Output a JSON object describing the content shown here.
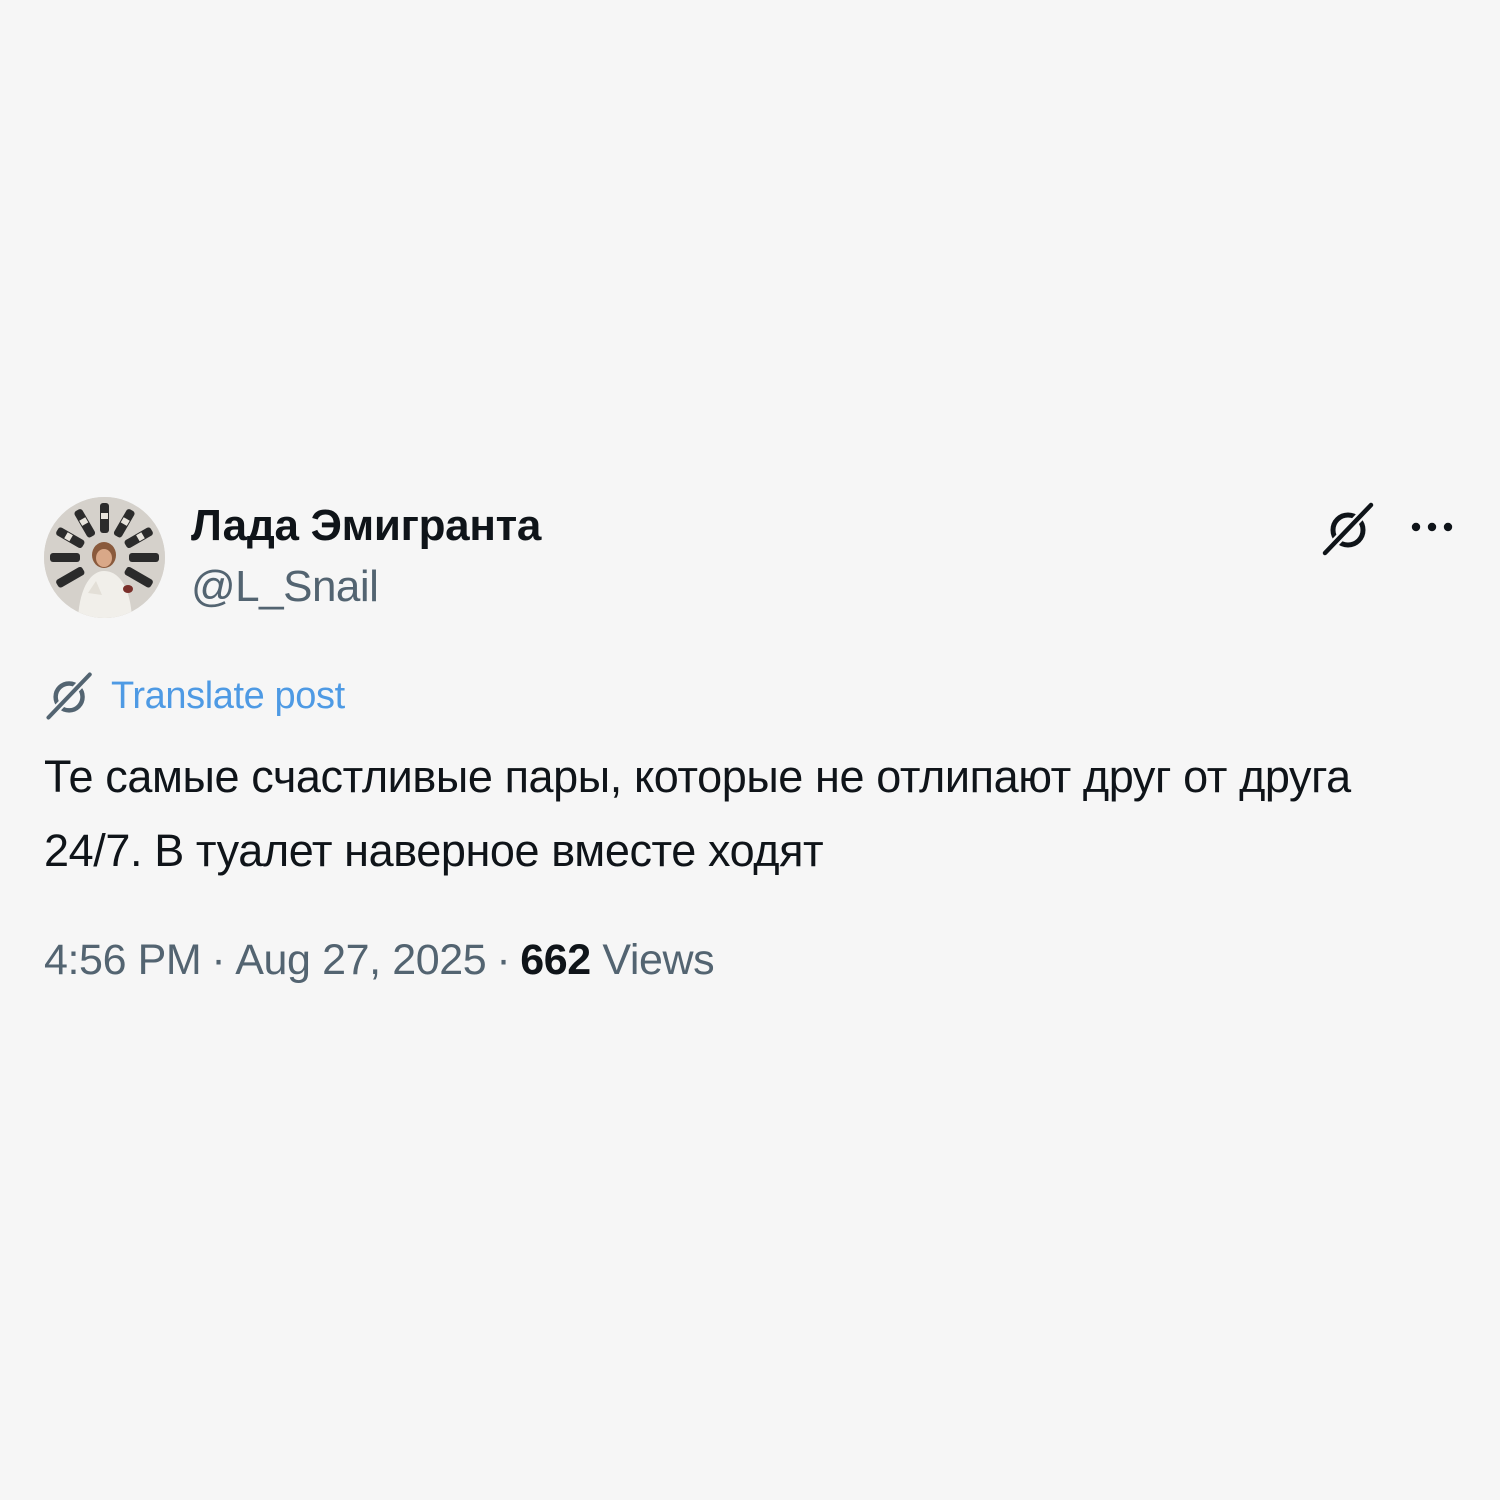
{
  "author": {
    "display_name": "Лада Эмигранта",
    "handle": "@L_Snail",
    "avatar_icon": "profile-photo-avatar"
  },
  "actions": {
    "grok_icon": "grok-icon",
    "more_icon": "more-options-icon"
  },
  "translate": {
    "label": "Translate post",
    "icon": "grok-icon",
    "color": "#4e9ae4"
  },
  "post": {
    "text": "Те самые счастливые пары, которые не отлипают друг от друга 24/7. В туалет наверное вместе ходят"
  },
  "meta": {
    "time": "4:56 PM",
    "separator": "·",
    "date": "Aug 27, 2025",
    "views_count": "662",
    "views_label": "Views"
  },
  "colors": {
    "background": "#f6f6f6",
    "text_primary": "#0f1419",
    "text_secondary": "#536471",
    "link": "#4e9ae4"
  }
}
